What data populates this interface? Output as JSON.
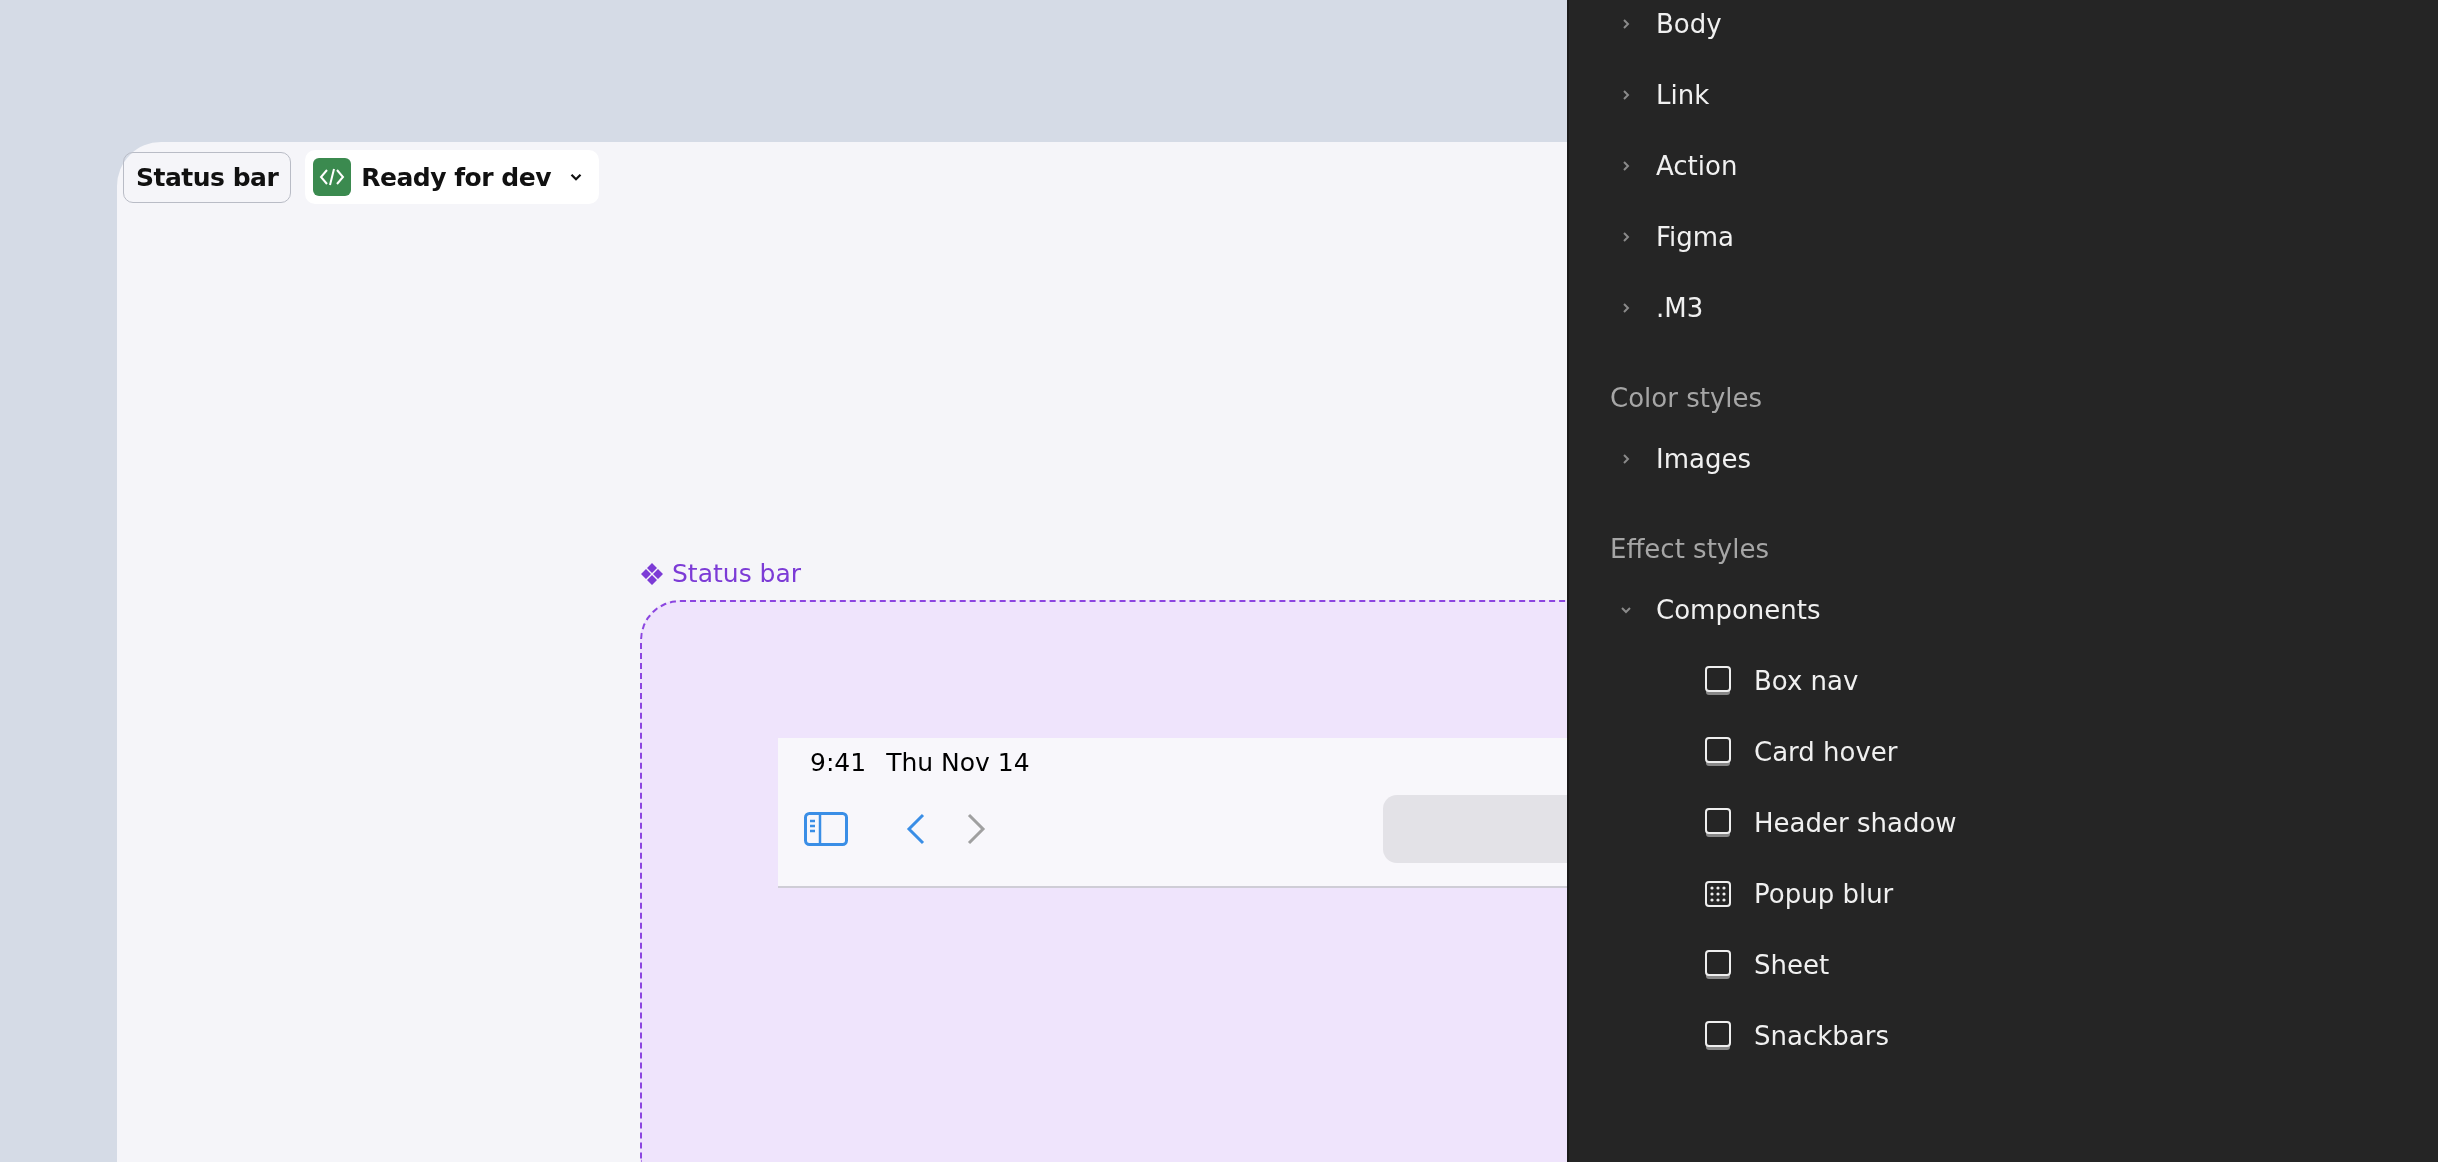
{
  "canvas": {
    "frame_name": "Status bar",
    "dev_status": {
      "label": "Ready for dev"
    },
    "component": {
      "label": "Status bar",
      "status_bar": {
        "time": "9:41",
        "date": "Thu Nov 14",
        "back_disabled": false,
        "forward_disabled": true
      }
    }
  },
  "panel": {
    "text_groups": [
      {
        "label": "Body",
        "expanded": false
      },
      {
        "label": "Link",
        "expanded": false
      },
      {
        "label": "Action",
        "expanded": false
      },
      {
        "label": "Figma",
        "expanded": false
      },
      {
        "label": ".M3",
        "expanded": false
      }
    ],
    "sections": [
      {
        "title": "Color styles",
        "groups": [
          {
            "label": "Images",
            "expanded": false
          }
        ]
      },
      {
        "title": "Effect styles",
        "groups": [
          {
            "label": "Components",
            "expanded": true,
            "children": [
              {
                "label": "Box nav",
                "kind": "shadow"
              },
              {
                "label": "Card hover",
                "kind": "shadow"
              },
              {
                "label": "Header shadow",
                "kind": "shadow"
              },
              {
                "label": "Popup blur",
                "kind": "blur"
              },
              {
                "label": "Sheet",
                "kind": "shadow"
              },
              {
                "label": "Snackbars",
                "kind": "shadow"
              }
            ]
          }
        ]
      }
    ]
  }
}
